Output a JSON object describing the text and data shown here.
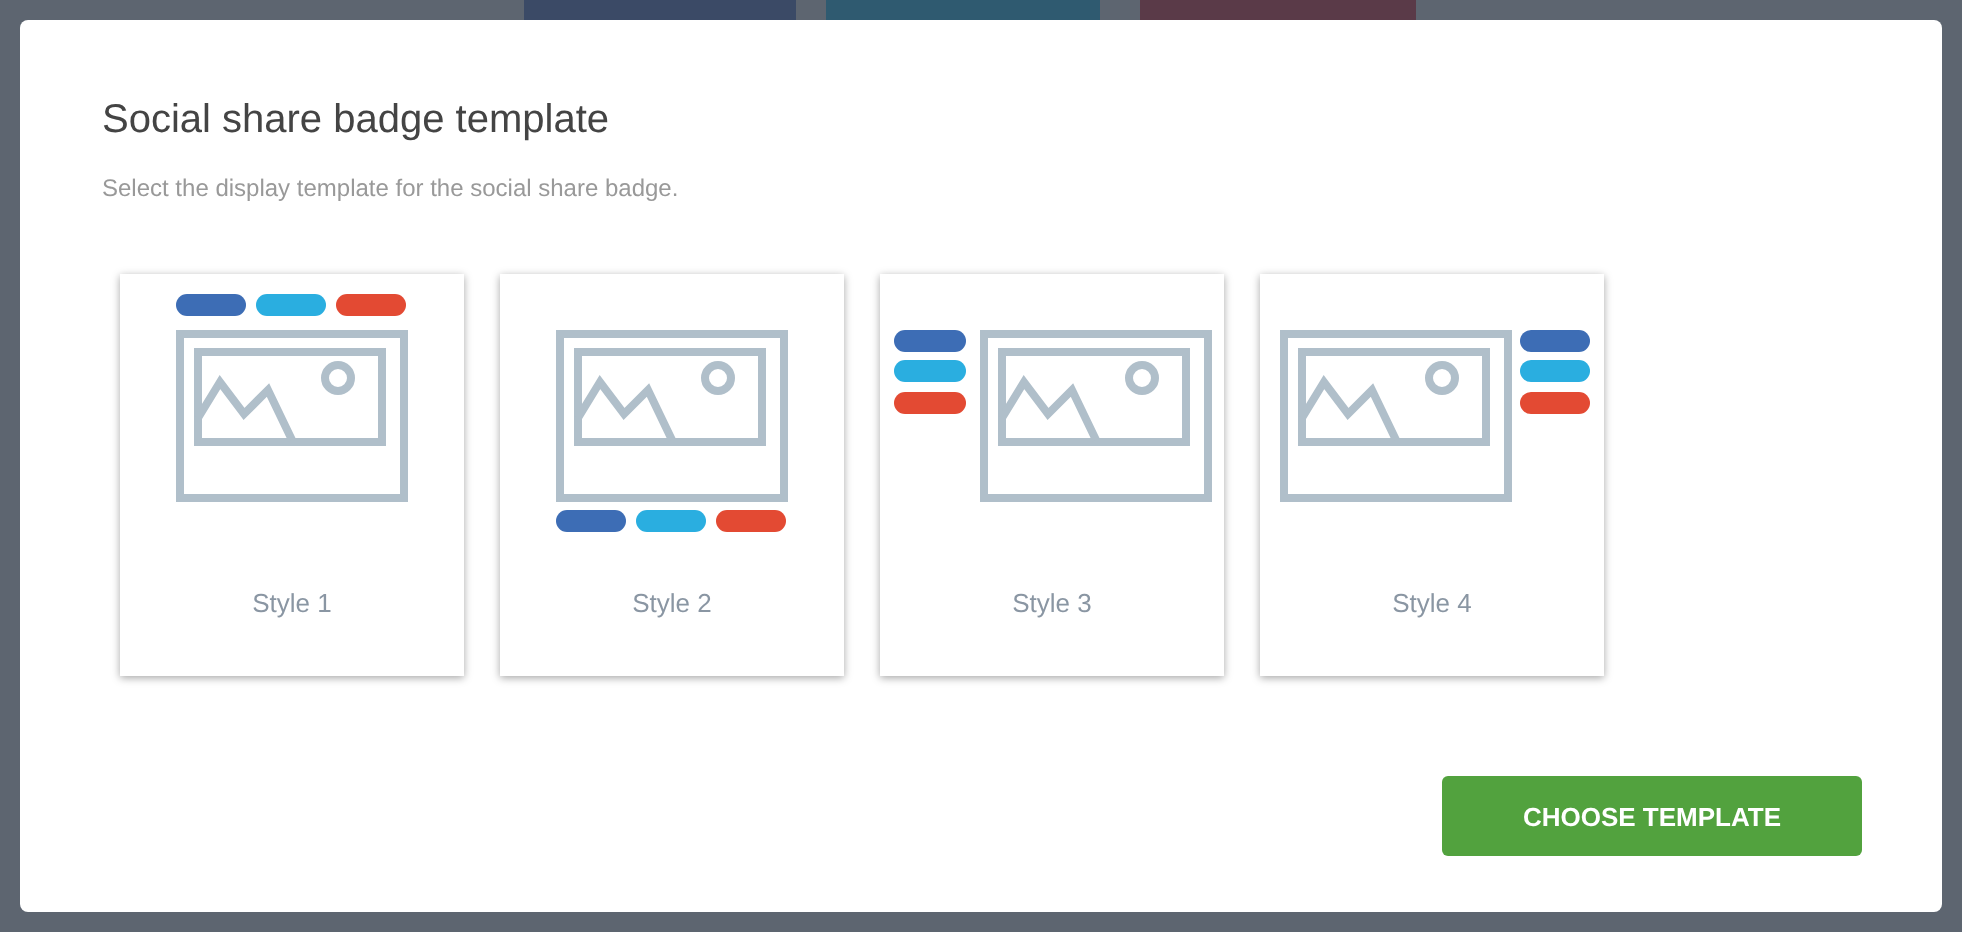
{
  "modal": {
    "title": "Social share badge template",
    "subtitle": "Select the display template for the social share badge.",
    "templates": [
      {
        "label": "Style 1",
        "kind": "top"
      },
      {
        "label": "Style 2",
        "kind": "bottom"
      },
      {
        "label": "Style 3",
        "kind": "left"
      },
      {
        "label": "Style 4",
        "kind": "right"
      }
    ],
    "button": "CHOOSE TEMPLATE"
  }
}
